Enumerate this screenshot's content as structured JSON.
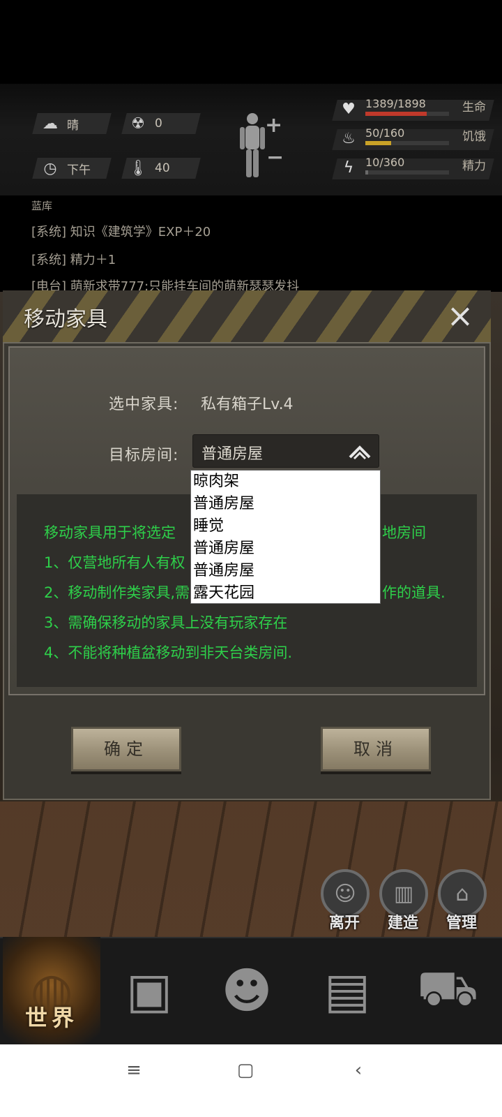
{
  "status": {
    "weather": "晴",
    "radiation": "0",
    "time_of_day": "下午",
    "temperature": "40",
    "body_plus": "+",
    "body_minus": "−",
    "stats": [
      {
        "value": "1389/1898",
        "label": "生命",
        "icon": "heart-icon",
        "fraction": 0.73,
        "color": "#c0392b"
      },
      {
        "value": "50/160",
        "label": "饥饿",
        "icon": "stomach-icon",
        "fraction": 0.31,
        "color": "#c9a227"
      },
      {
        "value": "10/360",
        "label": "精力",
        "icon": "energy-icon",
        "fraction": 0.03,
        "color": "#6a6a6a"
      }
    ]
  },
  "log": {
    "lines": [
      "蓝库",
      "[系统] 知识《建筑学》EXP＋20",
      "[系统] 精力＋1",
      "[电台] 萌新求带777:只能挂车间的萌新瑟瑟发抖"
    ]
  },
  "dialog": {
    "title": "移动家具",
    "close_icon": "×",
    "selected_label": "选中家具:",
    "selected_value": "私有箱子Lv.4",
    "target_label": "目标房间:",
    "target_value": "普通房屋",
    "dropdown_options": [
      "晾肉架",
      "普通房屋",
      "睡觉",
      "普通房屋",
      "普通房屋",
      "露天花园"
    ],
    "info_lines": [
      "移动家具用于将选定",
      "地房间",
      "1、仅营地所有人有权",
      "2、移动制作类家具,需",
      "作的道具.",
      "3、需确保移动的家具上没有玩家存在",
      "4、不能将种植盆移动到非天台类房间."
    ],
    "confirm_label": "确定",
    "cancel_label": "取消"
  },
  "actions": [
    {
      "label": "离开",
      "icon": "leave-icon"
    },
    {
      "label": "建造",
      "icon": "build-icon"
    },
    {
      "label": "管理",
      "icon": "manage-icon"
    }
  ],
  "nav": {
    "items": [
      {
        "label": "世界",
        "icon": "globe-icon",
        "active": true
      },
      {
        "label": "",
        "icon": "backpack-icon"
      },
      {
        "label": "",
        "icon": "head-gears-icon"
      },
      {
        "label": "",
        "icon": "radio-icon"
      },
      {
        "label": "",
        "icon": "cart-icon"
      }
    ]
  },
  "system_bar": {
    "menu": "≡",
    "home": "▢",
    "back": "‹"
  }
}
